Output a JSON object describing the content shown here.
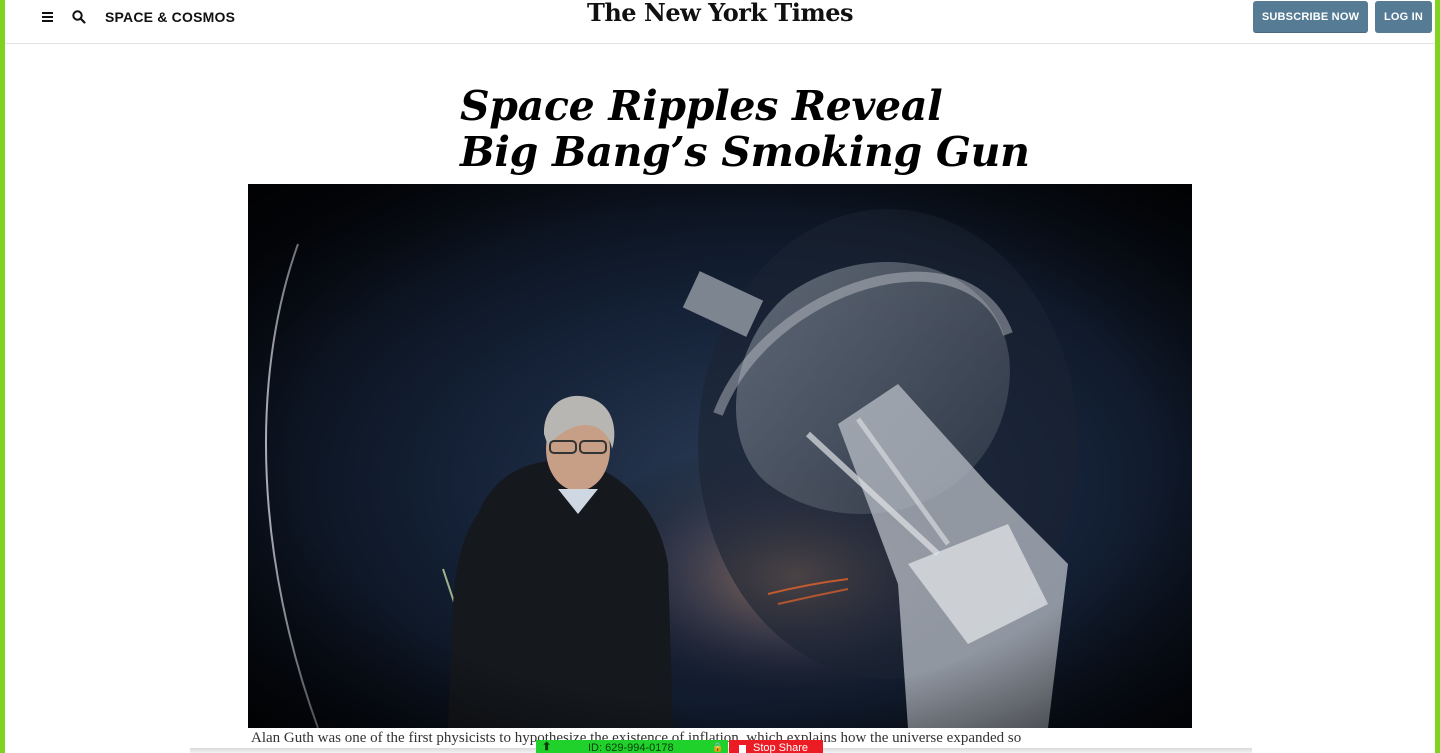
{
  "header": {
    "section_label": "SPACE & COSMOS",
    "logo_text": "The New York Times",
    "subscribe_label": "SUBSCRIBE NOW",
    "login_label": "LOG IN",
    "accent_color": "#567b95"
  },
  "article": {
    "headline_line1": "Space Ripples Reveal",
    "headline_line2": "Big Bang’s Smoking Gun",
    "caption": "Alan Guth was one of the first physicists to hypothesize the existence of inflation, which explains how the universe expanded so"
  },
  "screen_share": {
    "session_id": "ID: 629-994-0178",
    "stop_label": "Stop Share",
    "bar_color": "#1fd12a",
    "stop_color": "#ec1c24"
  },
  "icons": {
    "menu": "hamburger-icon",
    "search": "search-icon",
    "upload": "arrow-up-icon",
    "lock": "lock-icon",
    "stop": "stop-square-icon"
  }
}
